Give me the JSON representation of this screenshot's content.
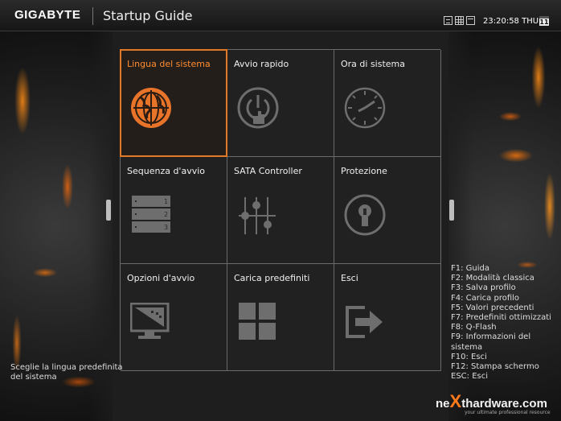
{
  "header": {
    "brand": "GIGABYTE",
    "title": "Startup Guide",
    "time": "23:20:58 THU",
    "calendar_day": "11",
    "icons": [
      "advanced-mode-icon",
      "easy-mode-icon",
      "window-icon"
    ]
  },
  "tiles": [
    {
      "label": "Lingua del sistema",
      "icon": "globe-icon",
      "selected": true
    },
    {
      "label": "Avvio rapido",
      "icon": "fast-boot-icon",
      "selected": false
    },
    {
      "label": "Ora di sistema",
      "icon": "clock-icon",
      "selected": false
    },
    {
      "label": "Sequenza d'avvio",
      "icon": "boot-sequence-icon",
      "selected": false
    },
    {
      "label": "SATA Controller",
      "icon": "sliders-icon",
      "selected": false
    },
    {
      "label": "Protezione",
      "icon": "lock-icon",
      "selected": false
    },
    {
      "label": "Opzioni d'avvio",
      "icon": "monitor-icon",
      "selected": false
    },
    {
      "label": "Carica predefiniti",
      "icon": "grid-icon",
      "selected": false
    },
    {
      "label": "Esci",
      "icon": "exit-icon",
      "selected": false
    }
  ],
  "help_text": "Sceglie la lingua predefinita del sistema",
  "function_keys": [
    "F1: Guida",
    "F2: Modalità classica",
    "F3: Salva profilo",
    "F4: Carica profilo",
    "F5: Valori precedenti",
    "F7: Predefiniti ottimizzati",
    "F8: Q-Flash",
    "F9: Informazioni del",
    "sistema",
    "F10: Esci",
    "F12: Stampa schermo",
    "ESC: Esci"
  ],
  "watermark": {
    "pre": "ne",
    "x": "X",
    "post": "thardware.com",
    "tagline": "your ultimate professional resource"
  },
  "colors": {
    "accent": "#e07a2a",
    "tile_border": "#6a6a6a",
    "icon_gray": "#6e6e6e"
  }
}
